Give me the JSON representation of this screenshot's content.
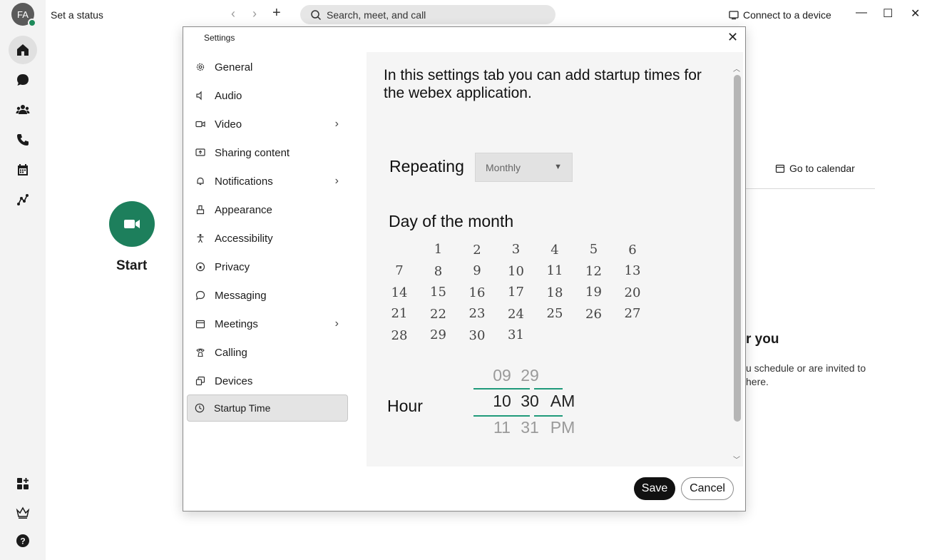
{
  "app": {
    "avatar_initials": "FA",
    "status_text": "Set a status",
    "search_placeholder": "Search, meet, and call",
    "connect_label": "Connect to a device",
    "nav_back": "‹",
    "nav_forward": "›",
    "new_label": "+",
    "minimize": "—",
    "maximize": "☐",
    "close": "✕"
  },
  "background": {
    "start_label": "Start",
    "go_to_calendar": "Go to calendar",
    "heading_fragment": "r you",
    "text_fragment": "u schedule or are invited to here."
  },
  "settings": {
    "title": "Settings",
    "close_glyph": "✕",
    "menu": [
      {
        "label": "General",
        "icon": "gear-icon"
      },
      {
        "label": "Audio",
        "icon": "speaker-icon"
      },
      {
        "label": "Video",
        "icon": "video-icon"
      },
      {
        "label": "Sharing content",
        "icon": "share-screen-icon"
      },
      {
        "label": "Notifications",
        "icon": "bell-icon"
      },
      {
        "label": "Appearance",
        "icon": "brush-icon"
      },
      {
        "label": "Accessibility",
        "icon": "accessibility-icon"
      },
      {
        "label": "Privacy",
        "icon": "privacy-icon"
      },
      {
        "label": "Messaging",
        "icon": "chat-bubble-icon"
      },
      {
        "label": "Meetings",
        "icon": "calendar-icon"
      },
      {
        "label": "Calling",
        "icon": "phone-icon"
      },
      {
        "label": "Devices",
        "icon": "devices-icon"
      },
      {
        "label": "Startup Time",
        "icon": "clock-icon",
        "selected": true
      }
    ],
    "chevron": "›",
    "intro": "In this settings tab you can add startup times for the webex application.",
    "repeating_label": "Repeating",
    "repeating_value": "Monthly",
    "dropdown_glyph": "▼",
    "day_of_month_label": "Day of the month",
    "days": [
      "1",
      "2",
      "3",
      "4",
      "5",
      "6",
      "7",
      "8",
      "9",
      "10",
      "11",
      "12",
      "13",
      "14",
      "15",
      "16",
      "17",
      "18",
      "19",
      "20",
      "21",
      "22",
      "23",
      "24",
      "25",
      "26",
      "27",
      "28",
      "29",
      "30",
      "31"
    ],
    "hour_label": "Hour",
    "hour": {
      "prev": "09",
      "current": "10",
      "next": "11"
    },
    "minute": {
      "prev": "29",
      "current": "30",
      "next": "31"
    },
    "ampm": {
      "current": "AM",
      "next": "PM"
    },
    "save_label": "Save",
    "cancel_label": "Cancel"
  },
  "colors": {
    "accent_green": "#1d7f5c",
    "picker_line": "#1f9a7a",
    "presence": "#1d8a5a"
  }
}
